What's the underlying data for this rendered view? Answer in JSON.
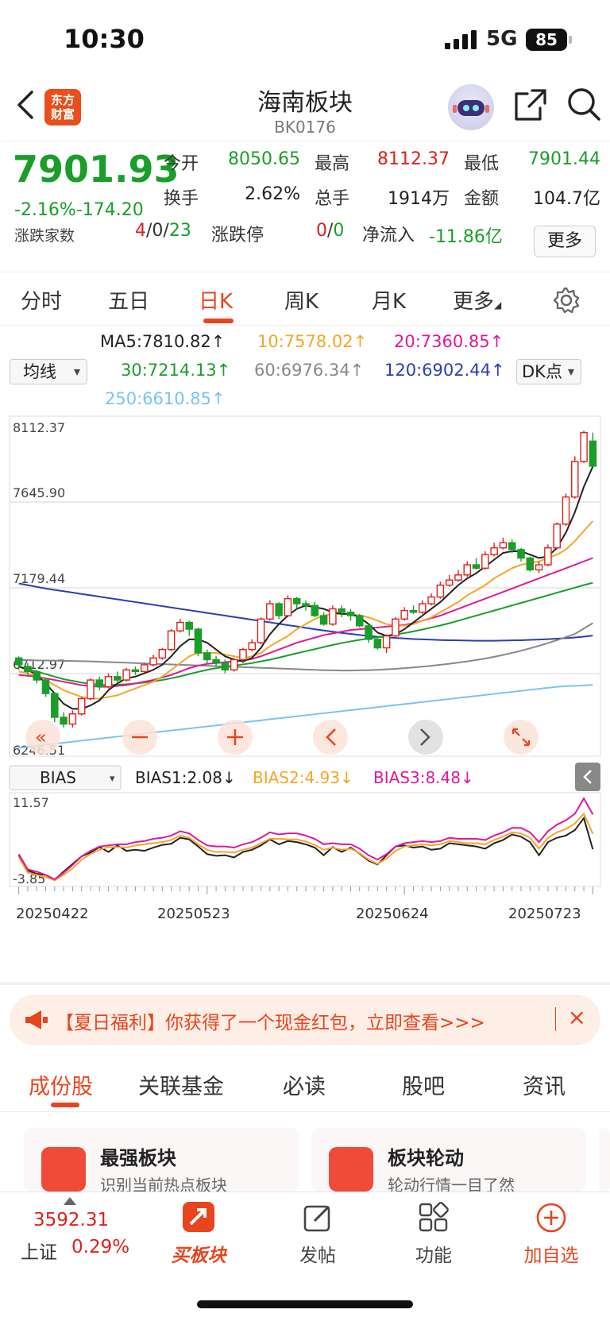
{
  "status": {
    "time": "10:30",
    "network": "5G",
    "battery": "85"
  },
  "header": {
    "logo_text": "东方财富",
    "title": "海南板块",
    "code": "BK0176"
  },
  "quote": {
    "price": "7901.93",
    "change_pct": "-2.16%",
    "change": "-174.20",
    "open_label": "今开",
    "open": "8050.65",
    "high_label": "最高",
    "high": "8112.37",
    "low_label": "最低",
    "low": "7901.44",
    "turnover_label": "换手",
    "turnover": "2.62%",
    "volume_label": "总手",
    "volume": "1914万",
    "amount_label": "金额",
    "amount": "104.7亿",
    "updown_label": "涨跌家数",
    "up": "4",
    "flat": "0",
    "down": "23",
    "limit_label": "涨跌停",
    "limit_up": "0",
    "limit_down": "0",
    "netflow_label": "净流入",
    "netflow": "-11.86亿",
    "more": "更多"
  },
  "period_tabs": [
    "分时",
    "五日",
    "日K",
    "周K",
    "月K",
    "更多"
  ],
  "ma": {
    "selector": "均线",
    "dk": "DK点",
    "ma5": "MA5:7810.82↑",
    "ma10": "10:7578.02↑",
    "ma20": "20:7360.85↑",
    "ma30": "30:7214.13↑",
    "ma60": "60:6976.34↑",
    "ma120": "120:6902.44↑",
    "ma250": "250:6610.85↑",
    "colors": {
      "ma5": "#222222",
      "ma10": "#f5a623",
      "ma20": "#e0189a",
      "ma30": "#1a9e2a",
      "ma60": "#888888",
      "ma120": "#2b3fb0",
      "ma250": "#7ac4f2"
    }
  },
  "chart_data": [
    {
      "type": "candlestick",
      "y_ticks": [
        "8112.37",
        "7645.90",
        "7179.44",
        "6712.97",
        "6246.51"
      ],
      "ylim": [
        6246.51,
        8112.37
      ],
      "x_ticks": [
        "20250422",
        "20250523",
        "20250624",
        "20250723"
      ],
      "candles": [
        [
          6770,
          6730,
          6780,
          6700
        ],
        [
          6720,
          6690,
          6740,
          6660
        ],
        [
          6690,
          6640,
          6700,
          6620
        ],
        [
          6640,
          6560,
          6650,
          6540
        ],
        [
          6560,
          6420,
          6570,
          6390
        ],
        [
          6420,
          6380,
          6450,
          6360
        ],
        [
          6380,
          6440,
          6460,
          6360
        ],
        [
          6440,
          6530,
          6540,
          6430
        ],
        [
          6530,
          6640,
          6650,
          6520
        ],
        [
          6640,
          6600,
          6660,
          6580
        ],
        [
          6600,
          6660,
          6680,
          6590
        ],
        [
          6660,
          6640,
          6690,
          6620
        ],
        [
          6640,
          6700,
          6710,
          6630
        ],
        [
          6700,
          6690,
          6720,
          6670
        ],
        [
          6690,
          6730,
          6740,
          6680
        ],
        [
          6730,
          6770,
          6790,
          6720
        ],
        [
          6770,
          6820,
          6830,
          6760
        ],
        [
          6820,
          6930,
          6940,
          6810
        ],
        [
          6930,
          6980,
          7000,
          6920
        ],
        [
          6980,
          6940,
          6990,
          6900
        ],
        [
          6940,
          6800,
          6950,
          6780
        ],
        [
          6800,
          6760,
          6820,
          6740
        ],
        [
          6760,
          6740,
          6780,
          6720
        ],
        [
          6740,
          6700,
          6760,
          6680
        ],
        [
          6700,
          6760,
          6770,
          6690
        ],
        [
          6760,
          6820,
          6830,
          6740
        ],
        [
          6820,
          6860,
          6880,
          6810
        ],
        [
          6860,
          7000,
          7010,
          6850
        ],
        [
          7000,
          7090,
          7110,
          6990
        ],
        [
          7090,
          7020,
          7100,
          7000
        ],
        [
          7020,
          7120,
          7140,
          7010
        ],
        [
          7120,
          7090,
          7130,
          7060
        ],
        [
          7090,
          7080,
          7110,
          7050
        ],
        [
          7080,
          7020,
          7100,
          7010
        ],
        [
          7020,
          6970,
          7040,
          6960
        ],
        [
          6970,
          7060,
          7080,
          6960
        ],
        [
          7060,
          7040,
          7080,
          7010
        ],
        [
          7040,
          7020,
          7060,
          6990
        ],
        [
          7020,
          6960,
          7030,
          6950
        ],
        [
          6960,
          6880,
          6970,
          6860
        ],
        [
          6880,
          6830,
          6900,
          6820
        ],
        [
          6830,
          6900,
          6910,
          6800
        ],
        [
          6900,
          7000,
          7010,
          6890
        ],
        [
          7000,
          7050,
          7070,
          6990
        ],
        [
          7050,
          7040,
          7080,
          7030
        ],
        [
          7040,
          7090,
          7110,
          7030
        ],
        [
          7090,
          7130,
          7150,
          7080
        ],
        [
          7130,
          7200,
          7220,
          7120
        ],
        [
          7200,
          7230,
          7260,
          7190
        ],
        [
          7230,
          7260,
          7290,
          7220
        ],
        [
          7260,
          7320,
          7340,
          7250
        ],
        [
          7320,
          7300,
          7360,
          7290
        ],
        [
          7300,
          7380,
          7400,
          7290
        ],
        [
          7380,
          7420,
          7450,
          7370
        ],
        [
          7420,
          7450,
          7480,
          7410
        ],
        [
          7450,
          7410,
          7470,
          7390
        ],
        [
          7410,
          7360,
          7420,
          7340
        ],
        [
          7360,
          7290,
          7370,
          7280
        ],
        [
          7290,
          7320,
          7340,
          7270
        ],
        [
          7320,
          7420,
          7440,
          7310
        ],
        [
          7420,
          7560,
          7570,
          7410
        ],
        [
          7560,
          7720,
          7740,
          7550
        ],
        [
          7720,
          7930,
          7960,
          7710
        ],
        [
          7930,
          8100,
          8112,
          7920
        ],
        [
          8050,
          7902,
          8100,
          7901
        ]
      ],
      "ma5_line": [
        6720,
        6700,
        6670,
        6620,
        6560,
        6500,
        6470,
        6470,
        6490,
        6520,
        6580,
        6620,
        6650,
        6660,
        6680,
        6700,
        6730,
        6780,
        6840,
        6880,
        6880,
        6860,
        6820,
        6780,
        6760,
        6750,
        6770,
        6830,
        6910,
        6970,
        7020,
        7060,
        7080,
        7070,
        7060,
        7040,
        7030,
        7030,
        7010,
        6970,
        6920,
        6900,
        6910,
        6940,
        6980,
        7020,
        7060,
        7100,
        7150,
        7200,
        7240,
        7270,
        7310,
        7350,
        7390,
        7400,
        7400,
        7380,
        7360,
        7370,
        7420,
        7510,
        7630,
        7780,
        7900
      ],
      "ma10_line": [
        6690,
        6680,
        6660,
        6640,
        6610,
        6580,
        6560,
        6540,
        6530,
        6530,
        6540,
        6550,
        6570,
        6590,
        6610,
        6630,
        6660,
        6700,
        6740,
        6780,
        6800,
        6800,
        6800,
        6790,
        6780,
        6770,
        6780,
        6800,
        6840,
        6870,
        6900,
        6940,
        6970,
        7000,
        7020,
        7030,
        7030,
        7030,
        7020,
        7010,
        6990,
        6970,
        6960,
        6960,
        6970,
        6990,
        7010,
        7040,
        7070,
        7100,
        7140,
        7170,
        7200,
        7240,
        7270,
        7300,
        7320,
        7330,
        7340,
        7360,
        7380,
        7410,
        7460,
        7520,
        7578
      ],
      "ma20_line": [
        6670,
        6665,
        6660,
        6650,
        6640,
        6630,
        6620,
        6610,
        6605,
        6600,
        6600,
        6605,
        6610,
        6620,
        6630,
        6640,
        6655,
        6670,
        6690,
        6710,
        6725,
        6735,
        6740,
        6745,
        6750,
        6755,
        6765,
        6780,
        6800,
        6820,
        6840,
        6860,
        6875,
        6890,
        6905,
        6915,
        6925,
        6935,
        6940,
        6945,
        6950,
        6955,
        6960,
        6965,
        6975,
        6990,
        7005,
        7020,
        7040,
        7060,
        7080,
        7100,
        7120,
        7140,
        7160,
        7180,
        7200,
        7220,
        7240,
        7260,
        7280,
        7300,
        7320,
        7340,
        7360
      ],
      "ma30_line": [
        6720,
        6705,
        6690,
        6675,
        6660,
        6645,
        6635,
        6625,
        6618,
        6612,
        6610,
        6612,
        6615,
        6620,
        6625,
        6632,
        6640,
        6650,
        6662,
        6675,
        6688,
        6700,
        6710,
        6718,
        6725,
        6732,
        6740,
        6750,
        6760,
        6772,
        6785,
        6798,
        6810,
        6822,
        6835,
        6847,
        6858,
        6868,
        6877,
        6885,
        6892,
        6900,
        6908,
        6917,
        6927,
        6938,
        6950,
        6962,
        6975,
        6990,
        7005,
        7020,
        7035,
        7050,
        7065,
        7080,
        7095,
        7110,
        7125,
        7140,
        7155,
        7170,
        7185,
        7200,
        7214
      ],
      "ma60_line": [
        6760,
        6758,
        6756,
        6755,
        6754,
        6753,
        6752,
        6751,
        6750,
        6748,
        6746,
        6744,
        6742,
        6740,
        6738,
        6736,
        6734,
        6732,
        6730,
        6728,
        6726,
        6724,
        6722,
        6720,
        6718,
        6716,
        6714,
        6712,
        6710,
        6708,
        6706,
        6704,
        6702,
        6700,
        6698,
        6697,
        6696,
        6696,
        6697,
        6698,
        6700,
        6703,
        6706,
        6710,
        6714,
        6719,
        6724,
        6730,
        6736,
        6743,
        6750,
        6758,
        6767,
        6777,
        6788,
        6800,
        6813,
        6827,
        6842,
        6858,
        6875,
        6893,
        6912,
        6944,
        6976
      ],
      "ma120_line": [
        7210,
        7200,
        7190,
        7180,
        7172,
        7164,
        7156,
        7148,
        7140,
        7132,
        7124,
        7116,
        7108,
        7100,
        7092,
        7084,
        7076,
        7068,
        7060,
        7052,
        7044,
        7036,
        7028,
        7020,
        7012,
        7004,
        6996,
        6988,
        6980,
        6972,
        6964,
        6956,
        6948,
        6940,
        6932,
        6925,
        6918,
        6912,
        6906,
        6900,
        6896,
        6892,
        6888,
        6885,
        6882,
        6880,
        6878,
        6876,
        6875,
        6874,
        6873,
        6872,
        6872,
        6872,
        6873,
        6874,
        6875,
        6877,
        6879,
        6881,
        6884,
        6887,
        6891,
        6896,
        6902
      ],
      "ma250_line": [
        6240,
        6246,
        6252,
        6258,
        6264,
        6270,
        6276,
        6282,
        6288,
        6294,
        6300,
        6306,
        6312,
        6318,
        6324,
        6330,
        6336,
        6342,
        6348,
        6354,
        6360,
        6366,
        6372,
        6378,
        6384,
        6390,
        6396,
        6402,
        6408,
        6414,
        6420,
        6426,
        6432,
        6438,
        6444,
        6450,
        6456,
        6462,
        6468,
        6474,
        6480,
        6486,
        6492,
        6498,
        6504,
        6510,
        6516,
        6522,
        6528,
        6534,
        6540,
        6546,
        6552,
        6558,
        6564,
        6570,
        6576,
        6582,
        6588,
        6594,
        6600,
        6604,
        6606,
        6608,
        6611
      ]
    },
    {
      "type": "line",
      "indicator": "BIAS",
      "y_ticks": [
        "11.57",
        "-3.85"
      ],
      "ylim": [
        -3.85,
        11.57
      ],
      "series": [
        {
          "name": "BIAS1:2.08↓",
          "color": "#222222",
          "values": [
            1.0,
            -1.8,
            -2.4,
            -2.6,
            -3.5,
            -2.0,
            -0.6,
            0.8,
            1.5,
            2.5,
            1.6,
            2.8,
            1.8,
            2.0,
            1.8,
            2.4,
            2.9,
            3.1,
            4.2,
            3.9,
            2.6,
            1.2,
            0.9,
            1.0,
            0.6,
            1.6,
            2.0,
            2.8,
            3.9,
            3.0,
            3.6,
            3.4,
            3.0,
            2.4,
            1.0,
            2.5,
            1.6,
            2.4,
            1.3,
            0.0,
            -0.7,
            1.0,
            2.6,
            2.8,
            2.4,
            2.6,
            2.0,
            2.2,
            3.2,
            3.0,
            2.8,
            2.6,
            2.2,
            3.2,
            3.8,
            4.8,
            4.4,
            3.4,
            1.0,
            3.4,
            4.2,
            4.6,
            5.6,
            7.8,
            2.1
          ]
        },
        {
          "name": "BIAS2:4.93↓",
          "color": "#f5a623",
          "values": [
            0.6,
            -2.2,
            -2.6,
            -3.0,
            -3.6,
            -2.6,
            -1.4,
            0.2,
            1.2,
            2.0,
            2.5,
            2.5,
            2.4,
            2.8,
            3.0,
            3.2,
            3.4,
            3.8,
            4.6,
            4.2,
            3.0,
            2.0,
            1.6,
            1.6,
            1.5,
            2.0,
            2.4,
            3.2,
            4.0,
            4.0,
            3.9,
            3.9,
            3.5,
            2.9,
            2.0,
            2.4,
            2.0,
            2.2,
            1.4,
            0.2,
            -0.6,
            0.4,
            1.8,
            2.6,
            2.8,
            3.0,
            2.8,
            3.0,
            3.6,
            3.4,
            3.2,
            3.2,
            3.0,
            3.8,
            4.4,
            5.2,
            5.0,
            4.2,
            2.2,
            4.2,
            5.2,
            5.8,
            6.8,
            8.6,
            4.93
          ]
        },
        {
          "name": "BIAS3:8.48↓",
          "color": "#e0189a",
          "values": [
            1.2,
            -1.6,
            -2.0,
            -2.6,
            -3.4,
            -2.2,
            -0.8,
            0.8,
            1.8,
            2.6,
            2.8,
            3.0,
            3.0,
            3.4,
            3.6,
            4.0,
            4.2,
            4.6,
            5.4,
            5.0,
            3.8,
            2.8,
            2.6,
            2.6,
            2.4,
            3.0,
            3.4,
            4.2,
            5.2,
            4.8,
            5.0,
            5.0,
            4.6,
            4.0,
            3.0,
            3.2,
            3.0,
            3.0,
            2.2,
            1.0,
            0.2,
            1.2,
            2.6,
            3.2,
            3.4,
            3.6,
            3.4,
            3.6,
            4.2,
            4.0,
            4.0,
            4.0,
            3.8,
            4.6,
            5.2,
            6.0,
            6.0,
            5.2,
            3.4,
            5.4,
            6.6,
            7.4,
            8.6,
            11.4,
            8.48
          ]
        }
      ]
    }
  ],
  "bias_selector": "BIAS",
  "ad": {
    "text": "【夏日福利】你获得了一个现金红包，立即查看>>>",
    "close": "×"
  },
  "content_tabs": [
    "成份股",
    "关联基金",
    "必读",
    "股吧",
    "资讯"
  ],
  "cards": [
    {
      "title": "最强板块",
      "sub": "识别当前热点板块"
    },
    {
      "title": "板块轮动",
      "sub": "轮动行情一目了然"
    }
  ],
  "tabbar": {
    "index_value": "3592.31",
    "index_name": "上证",
    "index_pct": "0.29%",
    "items": [
      "买板块",
      "发帖",
      "功能",
      "加自选"
    ]
  }
}
